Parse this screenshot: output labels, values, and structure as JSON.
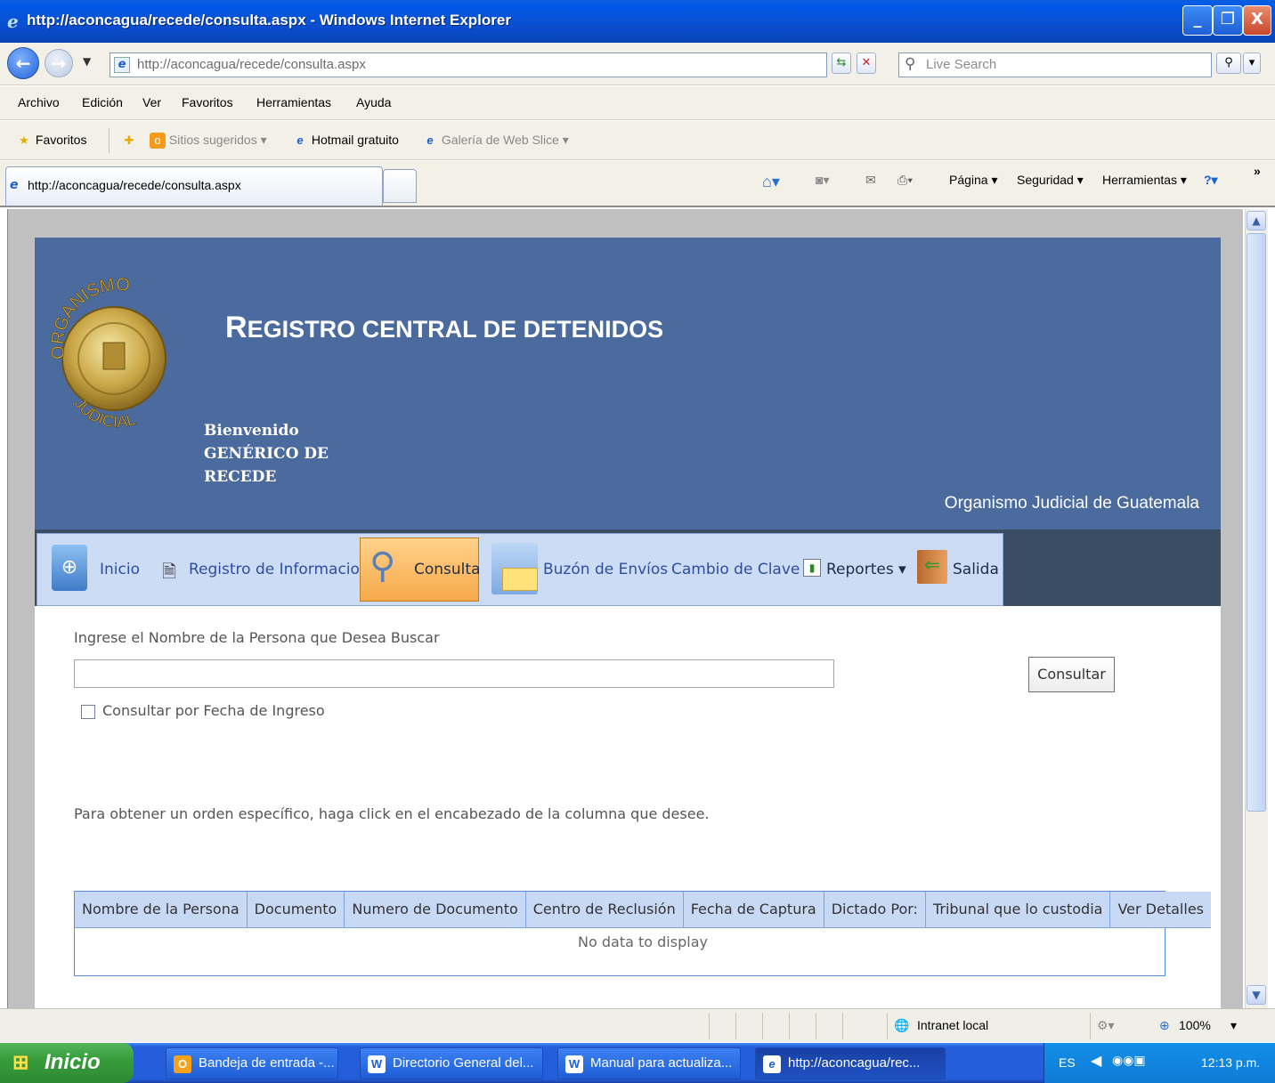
{
  "window": {
    "title": "http://aconcagua/recede/consulta.aspx - Windows Internet Explorer",
    "minimize": "_",
    "restore": "❐",
    "close": "X"
  },
  "addressbar": {
    "url": "http://aconcagua/recede/consulta.aspx",
    "search_placeholder": "Live Search"
  },
  "menu": [
    "Archivo",
    "Edición",
    "Ver",
    "Favoritos",
    "Herramientas",
    "Ayuda"
  ],
  "favorites_bar": {
    "favorites": "Favoritos",
    "sitios": "Sitios sugeridos ▾",
    "hotmail": "Hotmail gratuito",
    "galeria": "Galería de Web Slice ▾"
  },
  "tab": {
    "label": "http://aconcagua/recede/consulta.aspx"
  },
  "commandbar": {
    "pagina": "Página ▾",
    "seguridad": "Seguridad ▾",
    "herramientas": "Herramientas ▾"
  },
  "header": {
    "title_first": "R",
    "title_rest": "EGISTRO CENTRAL DE DETENIDOS",
    "welcome_1": "Bienvenido",
    "welcome_2": "GENÉRICO DE",
    "welcome_3": "RECEDE",
    "org": "Organismo Judicial de Guatemala",
    "seal_top": "ORGANISMO",
    "seal_bottom": "JUDICIAL"
  },
  "nav": {
    "inicio": "Inicio",
    "registro": "Registro de Informacion",
    "consulta": "Consulta",
    "buzon": "Buzón de Envíos",
    "cambio": "Cambio de Clave",
    "reportes": "Reportes ▾",
    "salida": "Salida"
  },
  "search": {
    "label": "Ingrese el Nombre de la Persona que Desea Buscar",
    "input_value": "",
    "button": "Consultar",
    "checkbox_label": "Consultar por Fecha de Ingreso",
    "checkbox_checked": false
  },
  "hint": "Para obtener un orden específico, haga click en el encabezado de la columna que desee.",
  "grid": {
    "columns": [
      "Nombre de la Persona",
      "Documento",
      "Numero de Documento",
      "Centro de Reclusión",
      "Fecha de Captura",
      "Dictado Por:",
      "Tribunal que lo custodia",
      "Ver Detalles"
    ],
    "empty_text": "No data to display"
  },
  "statusbar": {
    "zone": "Intranet local",
    "zoom": "100%"
  },
  "taskbar": {
    "start": "Inicio",
    "items": [
      "Bandeja de entrada -...",
      "Directorio General del...",
      "Manual para actualiza...",
      "http://aconcagua/rec..."
    ],
    "lang": "ES",
    "clock": "12:13 p.m."
  }
}
